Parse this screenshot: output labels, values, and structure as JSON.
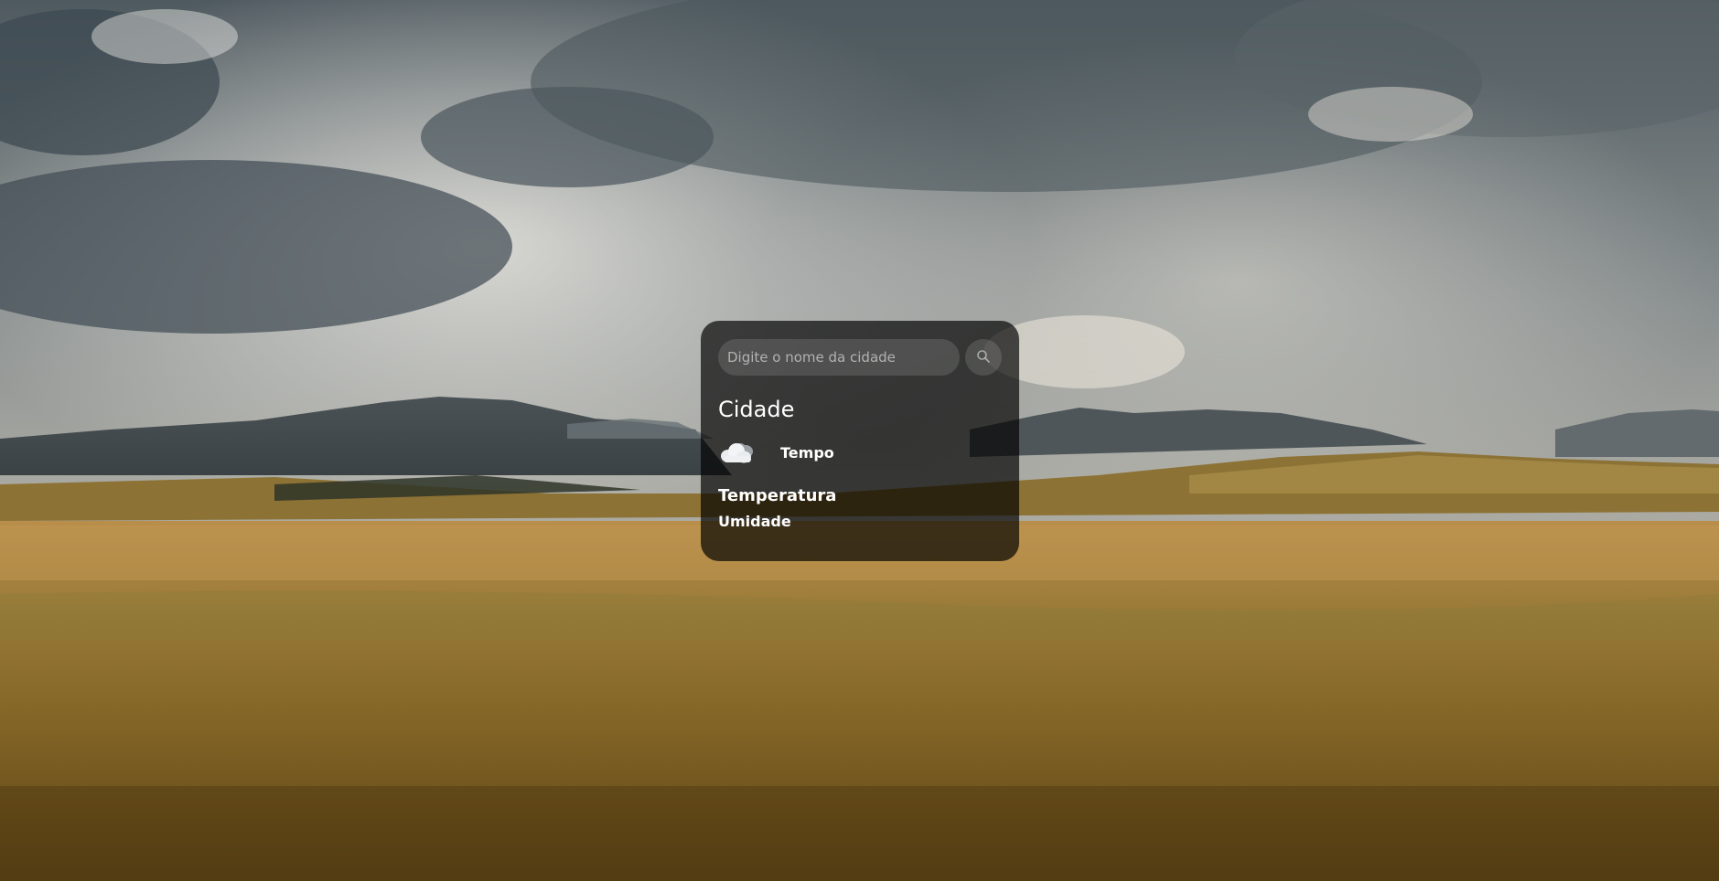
{
  "search": {
    "placeholder": "Digite o nome da cidade",
    "button_icon": "search-icon"
  },
  "weather": {
    "city": "Cidade",
    "icon": "cloud-icon",
    "description": "Tempo",
    "temperature_label": "Temperatura",
    "humidity_label": "Umidade"
  },
  "background": {
    "icon": "landscape-background-image"
  }
}
